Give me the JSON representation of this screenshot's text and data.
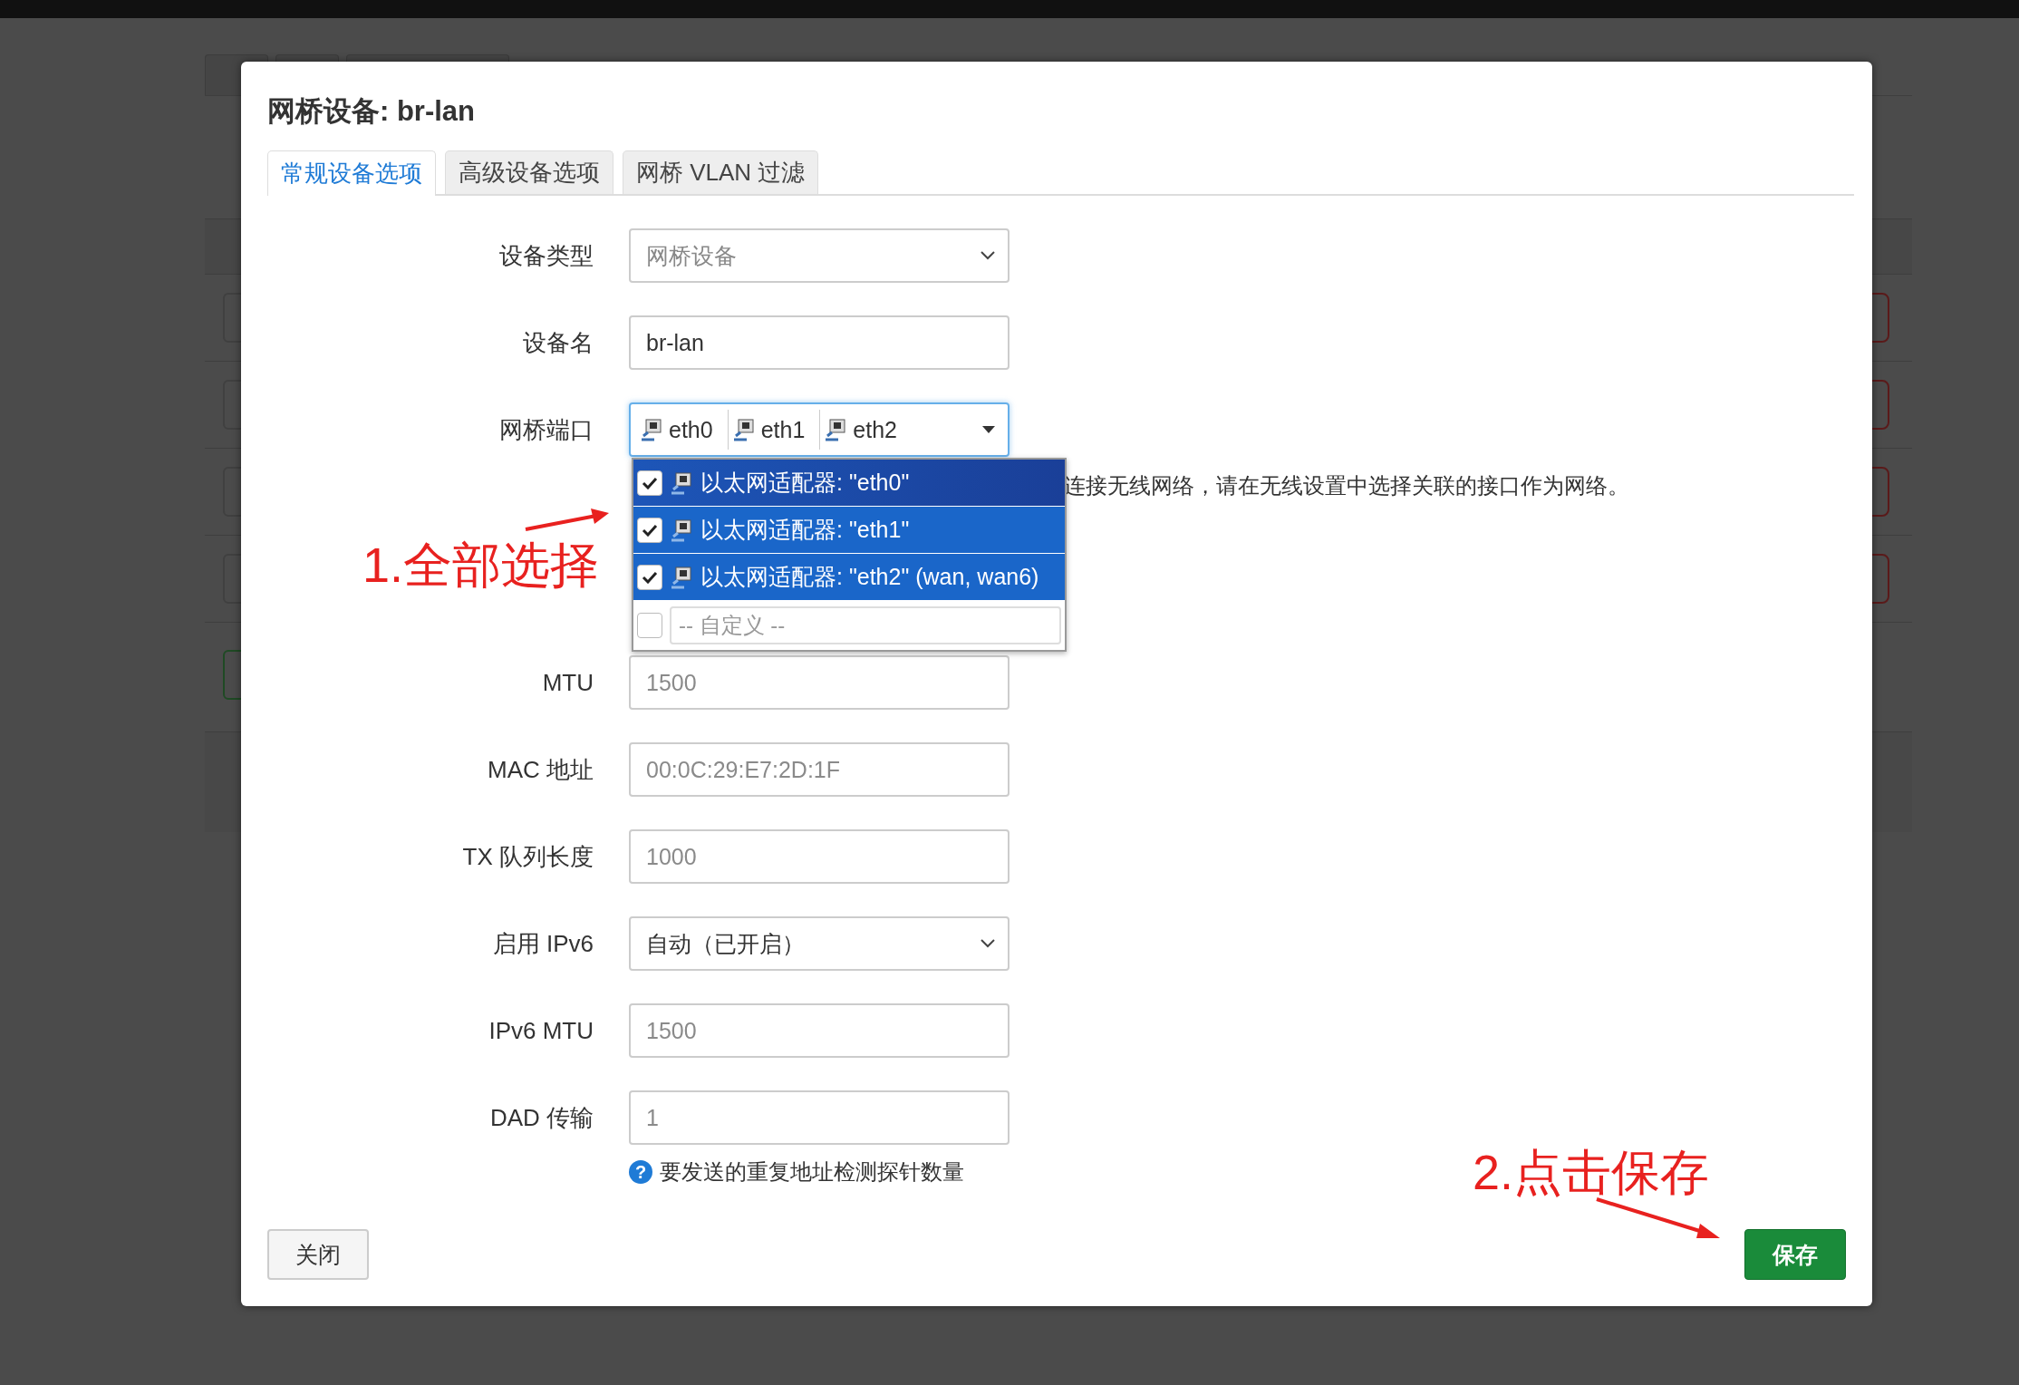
{
  "dialog": {
    "title": "网桥设备: br-lan",
    "tabs": [
      {
        "label": "常规设备选项",
        "selected": true
      },
      {
        "label": "高级设备选项",
        "selected": false
      },
      {
        "label": "网桥 VLAN 过滤",
        "selected": false
      }
    ],
    "fields": [
      {
        "label": "设备类型",
        "kind": "select",
        "value": "网桥设备",
        "disabled": true
      },
      {
        "label": "设备名",
        "kind": "text",
        "value": "br-lan"
      },
      {
        "label": "网桥端口",
        "kind": "ports",
        "ports": [
          "eth0",
          "eth1",
          "eth2"
        ],
        "help": "连接无线网络，请在无线设置中选择关联的接口作为网络。"
      },
      {
        "label": "MTU",
        "kind": "text",
        "placeholder": "1500"
      },
      {
        "label": "MAC 地址",
        "kind": "text",
        "placeholder": "00:0C:29:E7:2D:1F"
      },
      {
        "label": "TX 队列长度",
        "kind": "text",
        "placeholder": "1000"
      },
      {
        "label": "启用 IPv6",
        "kind": "select",
        "value": "自动（已开启）",
        "disabled": false
      },
      {
        "label": "IPv6 MTU",
        "kind": "text",
        "placeholder": "1500"
      },
      {
        "label": "DAD 传输",
        "kind": "text",
        "placeholder": "1",
        "help_icon": "?",
        "help": "要发送的重复地址检测探针数量"
      }
    ],
    "dropdown": {
      "options": [
        {
          "label": "以太网适配器: \"eth0\"",
          "checked": true,
          "highlighted": true
        },
        {
          "label": "以太网适配器: \"eth1\"",
          "checked": true,
          "highlighted": false
        },
        {
          "label": "以太网适配器: \"eth2\" (wan, wan6)",
          "checked": true,
          "highlighted": false
        }
      ],
      "custom_checked": false,
      "custom_placeholder": "-- 自定义 --"
    },
    "buttons": {
      "close": "关闭",
      "save": "保存"
    }
  },
  "annotations": [
    {
      "text": "1.全部选择"
    },
    {
      "text": "2.点击保存"
    }
  ]
}
